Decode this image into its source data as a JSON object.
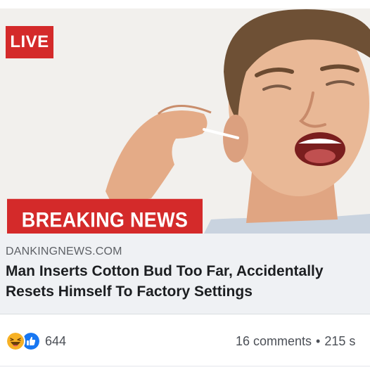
{
  "media": {
    "live_label": "LIVE",
    "banner_label": "BREAKING NEWS",
    "badge_color": "#d42a2a"
  },
  "link": {
    "site": "DANKINGNEWS.COM",
    "headline_line1": "Man Inserts Cotton Bud Too Far, Accidentally",
    "headline_line2": "Resets Himself To Factory Settings"
  },
  "footer": {
    "reaction_icons": [
      "haha-icon",
      "like-icon"
    ],
    "reaction_count": "644",
    "comments": "16 comments",
    "separator": "•",
    "shares": "215 s"
  }
}
